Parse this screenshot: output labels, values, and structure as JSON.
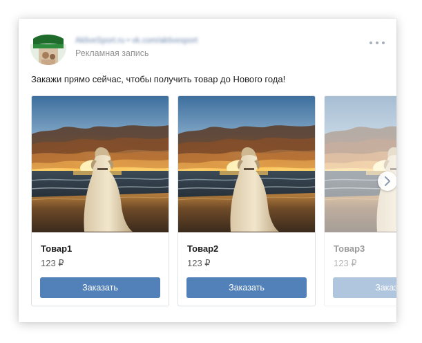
{
  "post": {
    "author_name": "AkliveSport.ru • vk.com/aktivesport",
    "subtitle": "Рекламная запись",
    "text": "Закажи прямо сейчас, чтобы получить товар до Нового года!"
  },
  "icons": {
    "more": "more-dots-icon",
    "next": "chevron-right-icon"
  },
  "products": [
    {
      "name": "Товар1",
      "price": "123 ₽",
      "button_label": "Заказать",
      "image": "dog-at-sunset"
    },
    {
      "name": "Товар2",
      "price": "123 ₽",
      "button_label": "Заказать",
      "image": "dog-at-sunset"
    },
    {
      "name": "Товар3",
      "price": "123 ₽",
      "button_label": "Заказать",
      "image": "dog-at-sunset"
    }
  ],
  "colors": {
    "button": "#5181b8",
    "button_text": "#ffffff",
    "subtitle": "#939393",
    "card_border": "#dce1e6"
  }
}
